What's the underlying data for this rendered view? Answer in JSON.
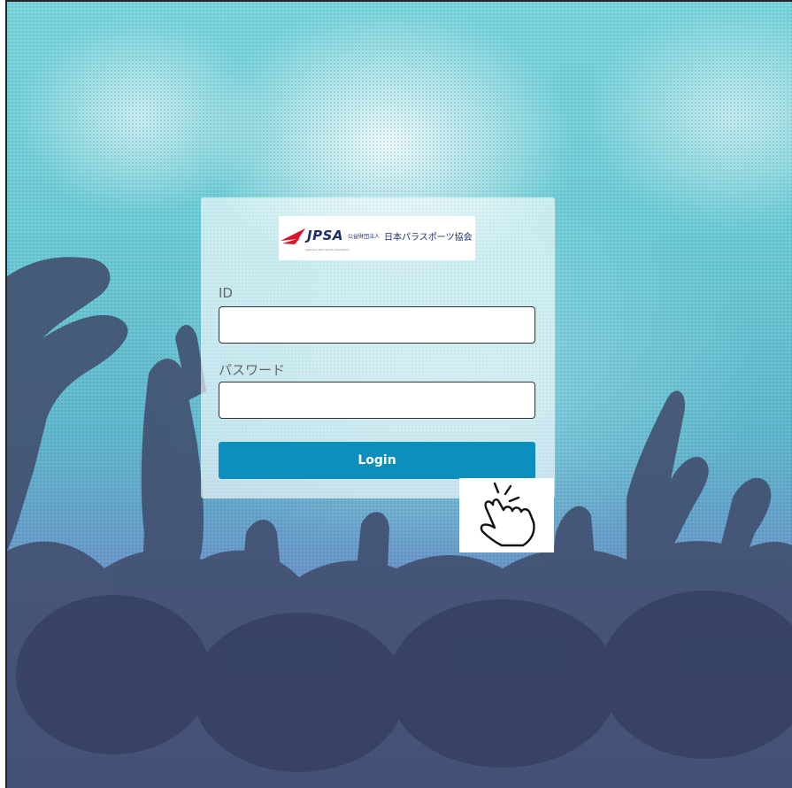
{
  "logo": {
    "brand": "JPSA",
    "org_small": "公益財団法人",
    "org_name": "日本パラスポーツ協会",
    "org_sub": "Japanese Para Sports Association",
    "accent": "#d8152b",
    "brand_color": "#1c2f6b"
  },
  "form": {
    "id_label": "ID",
    "id_value": "",
    "password_label": "パスワード",
    "password_value": "",
    "login_label": "Login",
    "button_color": "#0d8fbe"
  },
  "cursor": {
    "icon": "pointing-hand-click-icon"
  }
}
